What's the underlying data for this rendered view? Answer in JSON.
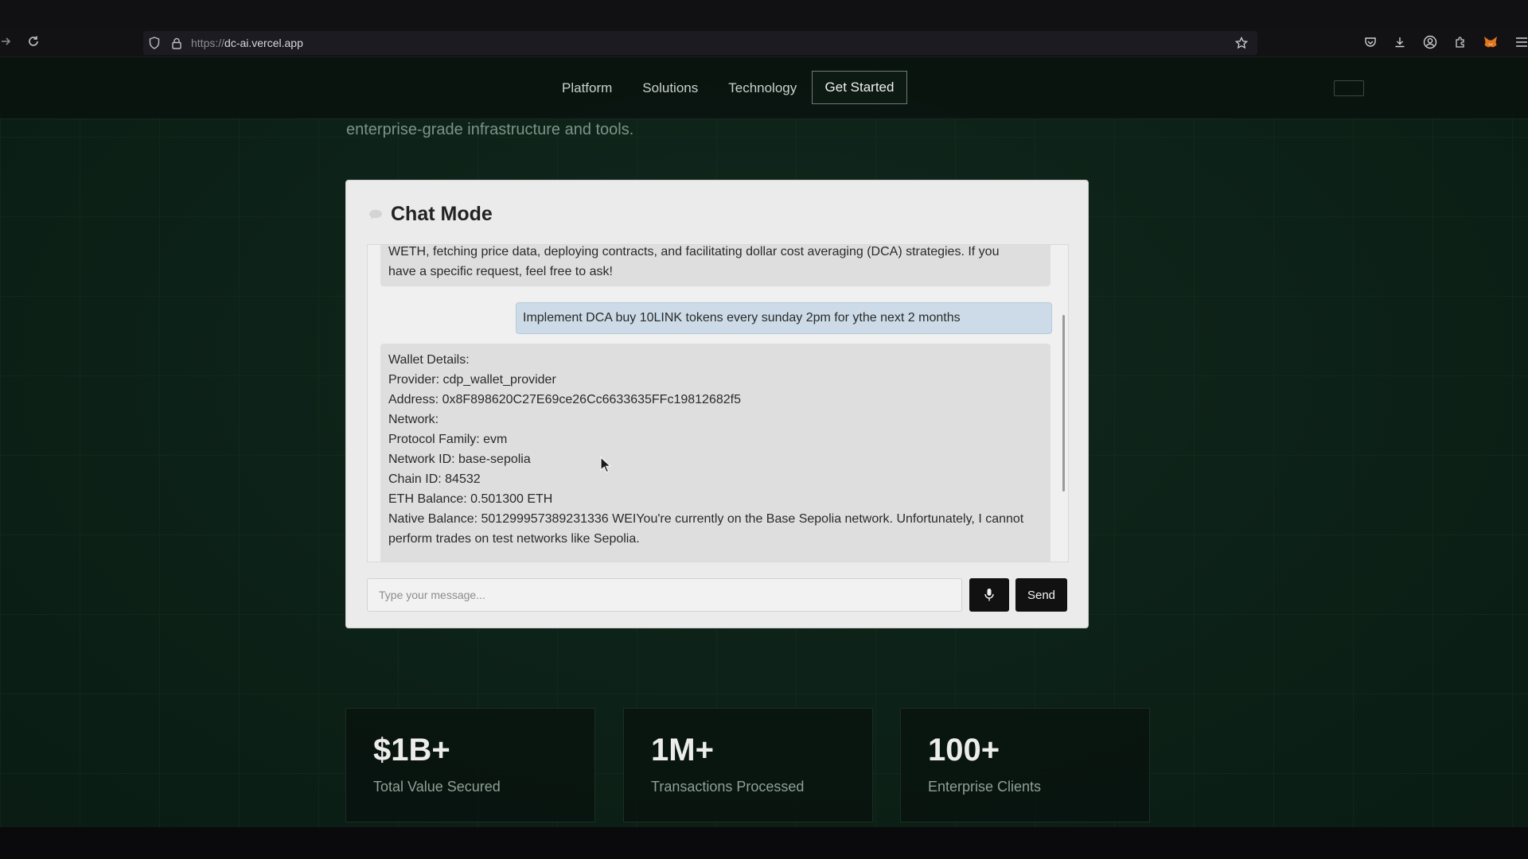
{
  "browser": {
    "url_protocol": "https://",
    "url_host": "dc-ai.vercel.app"
  },
  "nav": {
    "links": [
      "Platform",
      "Solutions",
      "Technology"
    ],
    "cta": "Get Started"
  },
  "intro_text": "enterprise-grade infrastructure and tools.",
  "chat": {
    "title": "Chat Mode",
    "messages": [
      {
        "role": "assistant",
        "lines": [
          "WETH, fetching price data, deploying contracts, and facilitating dollar cost averaging (DCA) strategies. If you",
          "have a specific request, feel free to ask!"
        ]
      },
      {
        "role": "user",
        "text": "Implement DCA buy 10LINK tokens every sunday 2pm for ythe next 2 months"
      },
      {
        "role": "assistant",
        "lines": [
          "Wallet Details:",
          "Provider: cdp_wallet_provider",
          "Address: 0x8F898620C27E69ce26Cc6633635FFc19812682f5",
          "Network:",
          "Protocol Family: evm",
          "Network ID: base-sepolia",
          "Chain ID: 84532",
          "ETH Balance: 0.501300 ETH",
          "Native Balance: 501299957389231336 WEIYou're currently on the Base Sepolia network. Unfortunately, I cannot",
          "perform trades on test networks like Sepolia."
        ]
      }
    ],
    "input_placeholder": "Type your message...",
    "send_label": "Send"
  },
  "stats": [
    {
      "value": "$1B+",
      "label": "Total Value Secured"
    },
    {
      "value": "1M+",
      "label": "Transactions Processed"
    },
    {
      "value": "100+",
      "label": "Enterprise Clients"
    }
  ],
  "colors": {
    "page_bg": "#0d2218",
    "card_bg": "#ebebeb",
    "user_bubble": "#ccdbe7",
    "bot_bubble": "#dedede",
    "button_dark": "#111111"
  }
}
